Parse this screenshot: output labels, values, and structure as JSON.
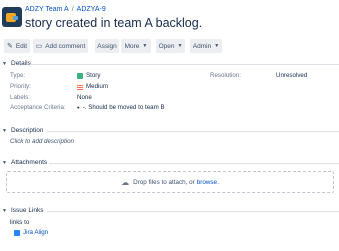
{
  "breadcrumb": {
    "project": "ADZY Team A",
    "separator": "/",
    "issue_key": "ADZYA-9"
  },
  "issue": {
    "title": "story created in team A backlog."
  },
  "toolbar": {
    "edit": "Edit",
    "add_comment": "Add comment",
    "assign": "Assign",
    "more": "More",
    "open": "Open",
    "admin": "Admin"
  },
  "details": {
    "heading": "Details",
    "type_label": "Type:",
    "type_value": "Story",
    "priority_label": "Priority:",
    "priority_value": "Medium",
    "labels_label": "Labels:",
    "labels_value": "None",
    "acceptance_label": "Acceptance Criteria:",
    "acceptance_value": "-. Should be moved to team B",
    "resolution_label": "Resolution:",
    "resolution_value": "Unresolved"
  },
  "description": {
    "heading": "Description",
    "placeholder": "Click to add description"
  },
  "attachments": {
    "heading": "Attachments",
    "drop_text": "Drop files to attach, or",
    "browse": "browse."
  },
  "issue_links": {
    "heading": "Issue Links",
    "links_to": "links to",
    "linked_item": "Jira Align"
  },
  "colors": {
    "link": "#0052cc",
    "button_bg": "#eceef1",
    "story": "#36b37e",
    "priority": "#ff7452"
  }
}
